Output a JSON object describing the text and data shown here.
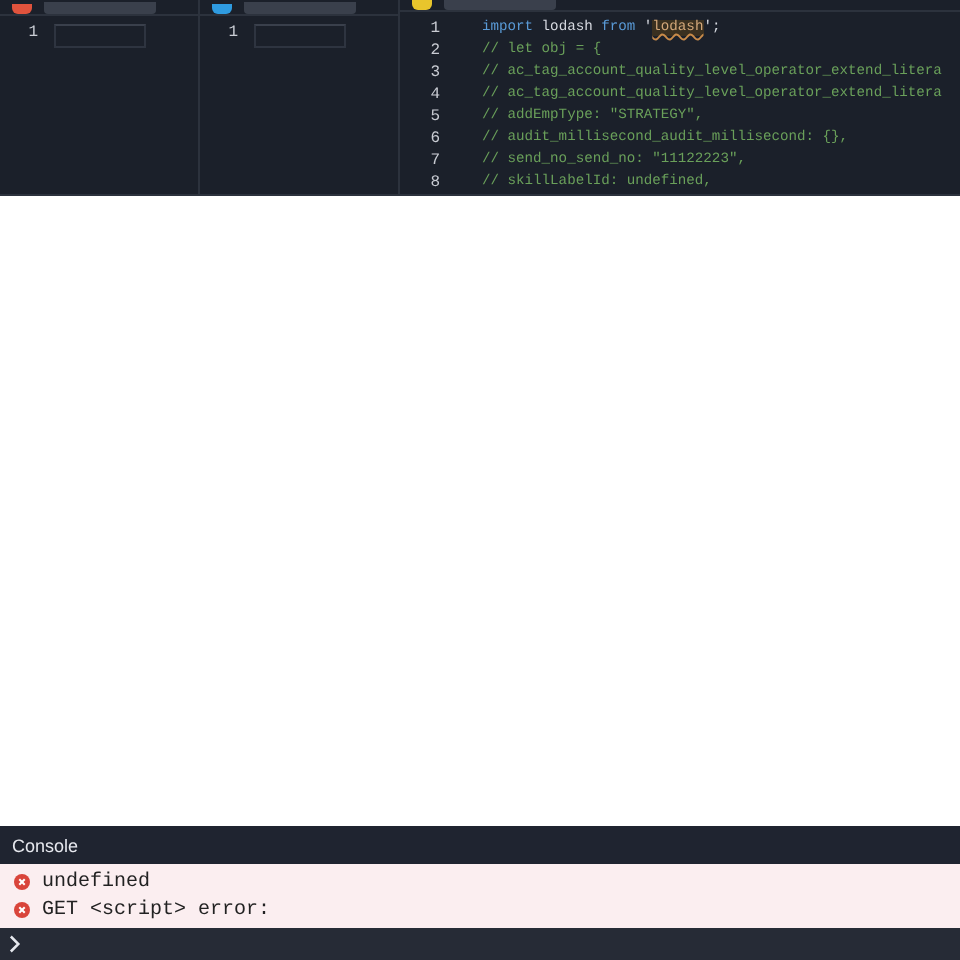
{
  "panes": [
    {
      "color": "#e0533d",
      "line_numbers": [
        "1"
      ]
    },
    {
      "color": "#2f9be0",
      "line_numbers": [
        "1"
      ]
    },
    {
      "color": "#e8c52c",
      "line_numbers": [
        "1",
        "2",
        "3",
        "4",
        "5",
        "6",
        "7",
        "8"
      ],
      "code_lines": [
        [
          {
            "kind": "keyword",
            "text": "import"
          },
          {
            "kind": "plain",
            "text": " lodash "
          },
          {
            "kind": "keyword",
            "text": "from"
          },
          {
            "kind": "plain",
            "text": " '"
          },
          {
            "kind": "underlined",
            "text": "lodash"
          },
          {
            "kind": "plain",
            "text": "';"
          }
        ],
        [
          {
            "kind": "comment",
            "text": "// let obj = {"
          }
        ],
        [
          {
            "kind": "comment",
            "text": "// ac_tag_account_quality_level_operator_extend_litera"
          }
        ],
        [
          {
            "kind": "comment",
            "text": "// ac_tag_account_quality_level_operator_extend_litera"
          }
        ],
        [
          {
            "kind": "comment",
            "text": "// addEmpType: \"STRATEGY\","
          }
        ],
        [
          {
            "kind": "comment",
            "text": "// audit_millisecond_audit_millisecond: {},"
          }
        ],
        [
          {
            "kind": "comment",
            "text": "// send_no_send_no: \"11122223\","
          }
        ],
        [
          {
            "kind": "comment",
            "text": "// skillLabelId: undefined,"
          }
        ]
      ]
    }
  ],
  "console": {
    "title": "Console",
    "messages": [
      {
        "kind": "error",
        "text": "undefined"
      },
      {
        "kind": "error",
        "text": "GET <script> error:"
      }
    ]
  }
}
